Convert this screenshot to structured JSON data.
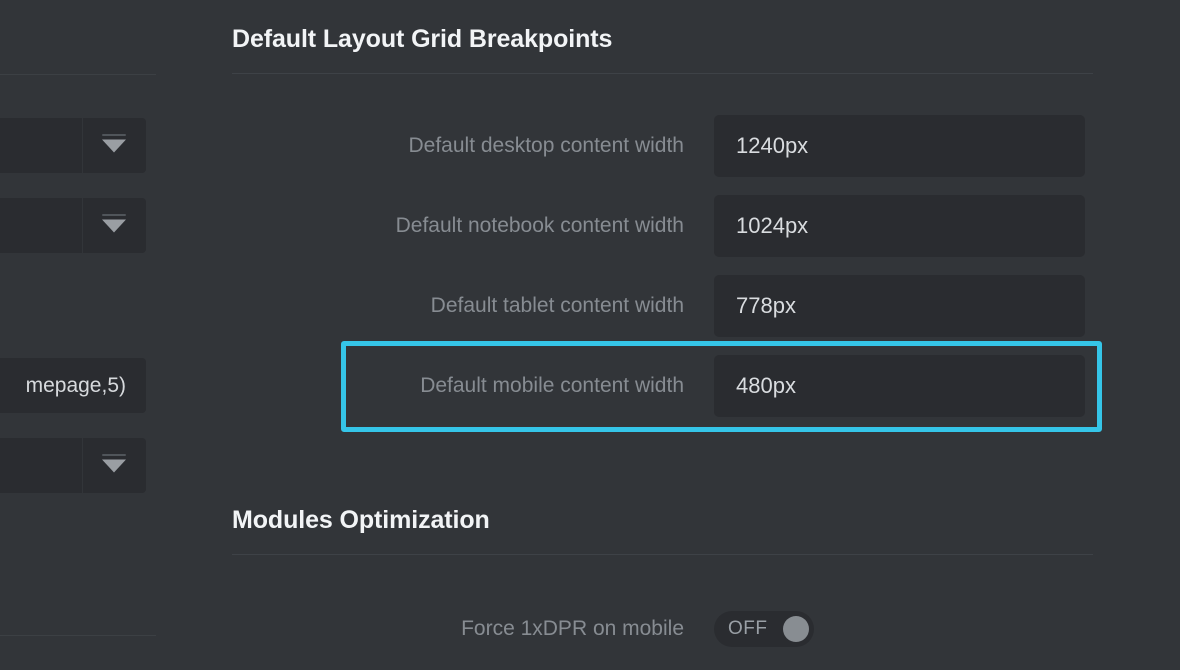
{
  "theme": {
    "background": "#323539",
    "field_background": "#2a2c30",
    "label_color": "#878c92",
    "value_color": "#d9dcdf",
    "heading_color": "#f2f4f6",
    "divider_color": "#3e4247",
    "highlight_color": "#35c5e8"
  },
  "left_panel": {
    "selects": [
      {
        "name": "select-1",
        "value": "",
        "icon": "chevron-down-icon"
      },
      {
        "name": "select-2",
        "value": "",
        "icon": "chevron-down-icon"
      },
      {
        "name": "select-3",
        "value": "",
        "icon": "chevron-down-icon"
      }
    ],
    "text_field": {
      "value": "mepage,5)"
    }
  },
  "sections": [
    {
      "title": "Default Layout Grid Breakpoints",
      "fields": [
        {
          "label": "Default desktop content width",
          "value": "1240px",
          "highlighted": false
        },
        {
          "label": "Default notebook content width",
          "value": "1024px",
          "highlighted": false
        },
        {
          "label": "Default tablet content width",
          "value": "778px",
          "highlighted": false
        },
        {
          "label": "Default mobile content width",
          "value": "480px",
          "highlighted": true
        }
      ]
    },
    {
      "title": "Modules Optimization",
      "fields": [
        {
          "label": "Force 1xDPR on mobile",
          "value": "OFF",
          "type": "toggle",
          "highlighted": false
        }
      ]
    }
  ]
}
